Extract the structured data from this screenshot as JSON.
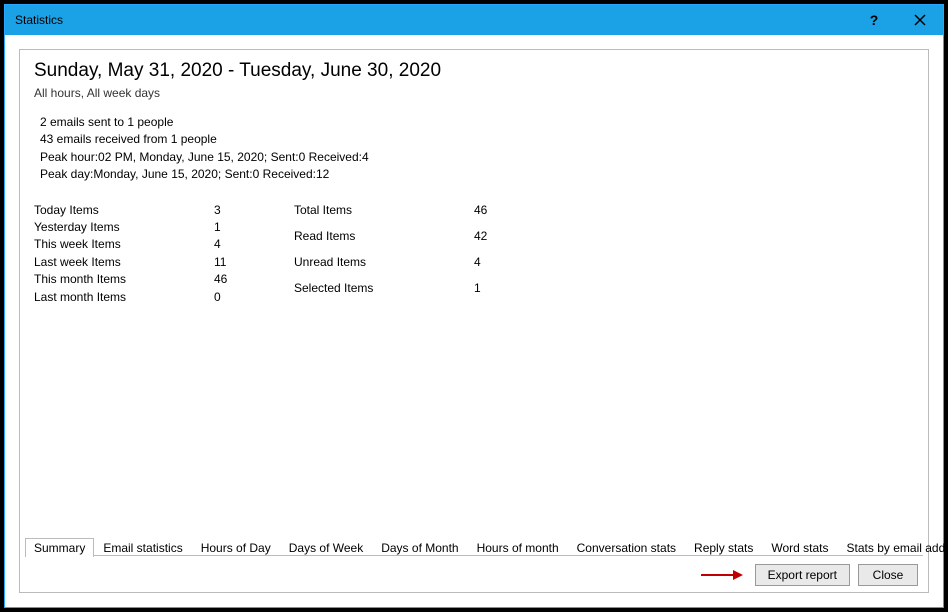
{
  "window": {
    "title": "Statistics"
  },
  "header": {
    "date_range": "Sunday, May 31, 2020 - Tuesday, June 30, 2020",
    "filter_text": "All hours, All week days"
  },
  "summary": {
    "line1": "2 emails sent to 1 people",
    "line2": "43 emails received from 1 people",
    "line3": "Peak hour:02 PM, Monday, June 15, 2020; Sent:0 Received:4",
    "line4": "Peak day:Monday, June 15, 2020; Sent:0 Received:12"
  },
  "stats_left": [
    {
      "label": "Today Items",
      "value": "3"
    },
    {
      "label": "Yesterday Items",
      "value": "1"
    },
    {
      "label": "This week Items",
      "value": "4"
    },
    {
      "label": "Last week Items",
      "value": "11"
    },
    {
      "label": "This month Items",
      "value": "46"
    },
    {
      "label": "Last month Items",
      "value": "0"
    }
  ],
  "stats_right": [
    {
      "label": "Total Items",
      "value": "46"
    },
    {
      "label": "Read Items",
      "value": "42"
    },
    {
      "label": "Unread Items",
      "value": "4"
    },
    {
      "label": "Selected Items",
      "value": "1"
    }
  ],
  "tabs": [
    "Summary",
    "Email statistics",
    "Hours of Day",
    "Days of Week",
    "Days of Month",
    "Hours of month",
    "Conversation stats",
    "Reply stats",
    "Word stats",
    "Stats by email address"
  ],
  "active_tab_index": 0,
  "buttons": {
    "export": "Export report",
    "close": "Close"
  }
}
